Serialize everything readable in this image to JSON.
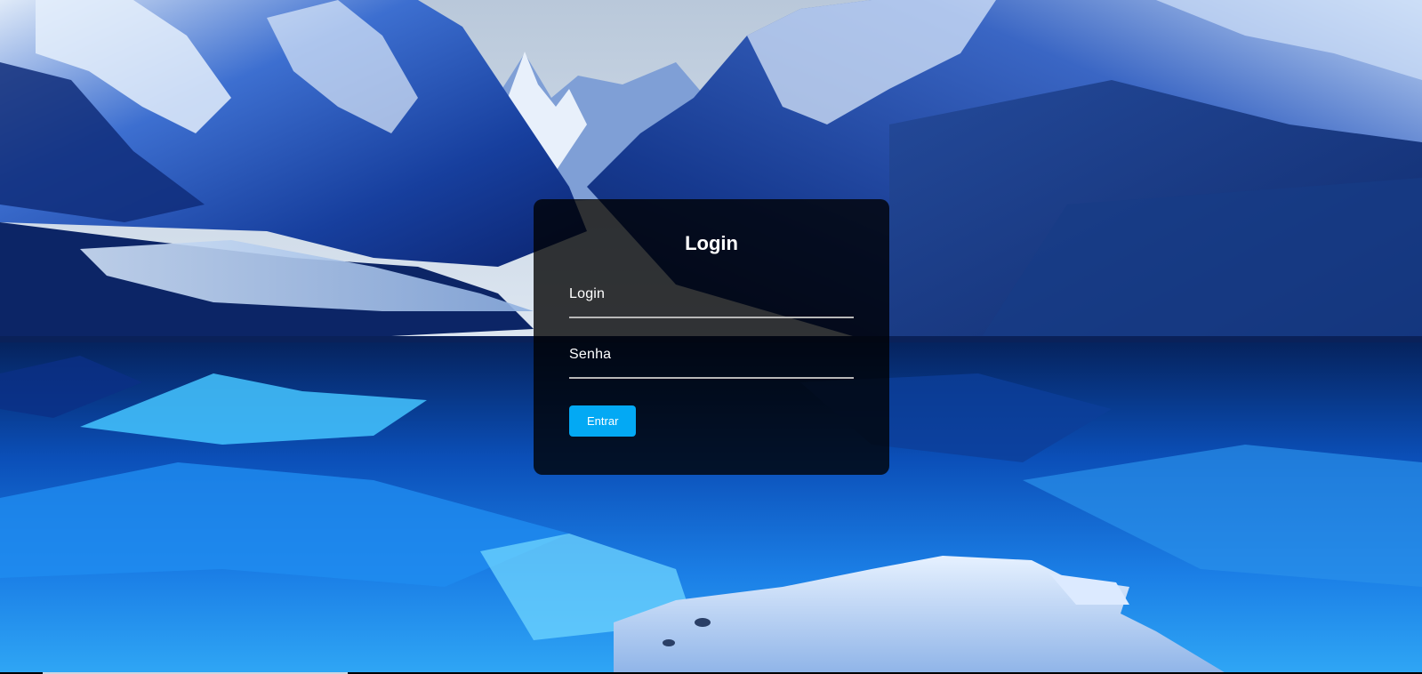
{
  "login_form": {
    "title": "Login",
    "login_field": {
      "label": "Login",
      "value": ""
    },
    "password_field": {
      "label": "Senha",
      "value": ""
    },
    "submit_label": "Entrar"
  },
  "colors": {
    "panel": "rgba(0,0,0,0.78)",
    "button": "#03a9f4",
    "text": "#ffffff",
    "underline": "#b8b8b8"
  },
  "background": {
    "subject": "snowy-mountains-reflected-in-blue-lake"
  }
}
